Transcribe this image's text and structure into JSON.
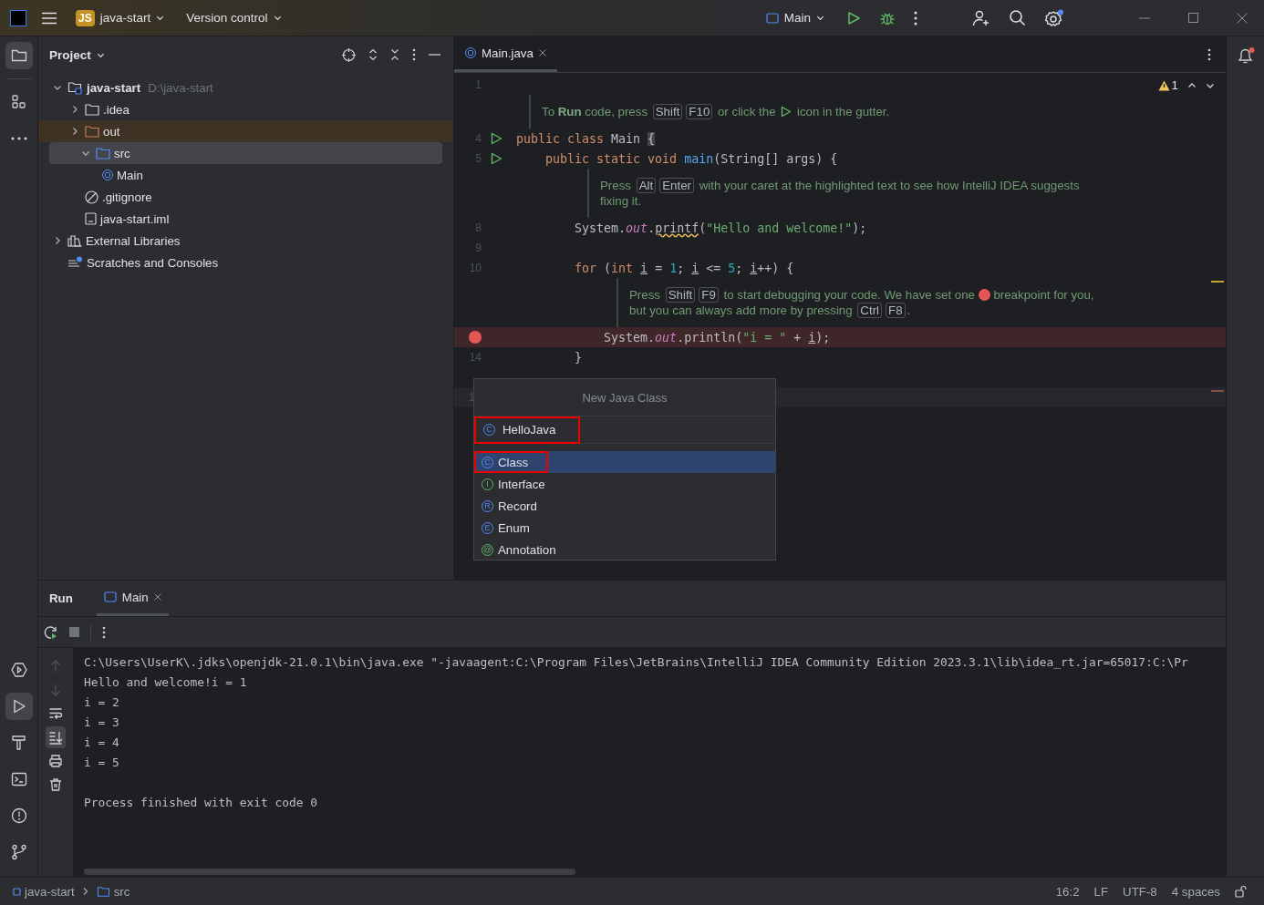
{
  "title_bar": {
    "project_badge": "JS",
    "project": "java-start",
    "vcs": "Version control",
    "run_config": "Main",
    "settings_badge": true
  },
  "left_toolbar_top": [
    {
      "kind": "project",
      "selected": true
    },
    {
      "kind": "structure",
      "selected": false
    },
    {
      "kind": "more",
      "selected": false
    }
  ],
  "left_toolbar_bottom": [
    {
      "kind": "services",
      "selected": false
    },
    {
      "kind": "run",
      "selected": true
    },
    {
      "kind": "build",
      "selected": false
    },
    {
      "kind": "terminal",
      "selected": false
    },
    {
      "kind": "problems",
      "selected": false
    },
    {
      "kind": "git",
      "selected": false
    }
  ],
  "project_panel": {
    "title": "Project",
    "tree": [
      {
        "label": "java-start",
        "path": "D:\\java-start",
        "kind": "module",
        "expanded": true,
        "selected": false,
        "children": [
          {
            "label": ".idea",
            "kind": "folder",
            "expanded": false,
            "selected": false
          },
          {
            "label": "out",
            "kind": "excluded-folder",
            "expanded": false,
            "selected": false
          },
          {
            "label": "src",
            "kind": "source-folder",
            "expanded": true,
            "selected": true,
            "children": [
              {
                "label": "Main",
                "kind": "class",
                "selected": false
              }
            ]
          },
          {
            "label": ".gitignore",
            "kind": "ignore-file",
            "selected": false
          },
          {
            "label": "java-start.iml",
            "kind": "file",
            "selected": false
          }
        ]
      },
      {
        "label": "External Libraries",
        "kind": "libraries",
        "expanded": false,
        "selected": false
      },
      {
        "label": "Scratches and Consoles",
        "kind": "scratches",
        "selected": false
      }
    ]
  },
  "editor": {
    "tab": {
      "label": "Main.java",
      "selected": true
    },
    "warnings": "1",
    "lines": [
      {
        "kind": "code",
        "number": "1",
        "current": false
      },
      {
        "kind": "hint",
        "parts": [
          {
            "kind": "text",
            "text": "To "
          },
          {
            "kind": "bold",
            "text": "Run"
          },
          {
            "kind": "text",
            "text": " code, press "
          },
          {
            "kind": "key",
            "text": "Shift"
          },
          {
            "kind": "key",
            "text": "F10"
          },
          {
            "kind": "text",
            "text": " or click the "
          },
          {
            "kind": "run-icon"
          },
          {
            "kind": "text",
            "text": " icon in the gutter."
          }
        ]
      },
      {
        "kind": "code",
        "number": "4",
        "runnable": true,
        "current": false,
        "tokens": [
          {
            "kind": "kw",
            "text": "public class "
          },
          {
            "kind": "plain",
            "text": "Main "
          },
          {
            "kind": "brace",
            "text": "{"
          }
        ]
      },
      {
        "kind": "code",
        "number": "5",
        "runnable": true,
        "current": false,
        "tokens": [
          {
            "kind": "kw",
            "text": "    public static void "
          },
          {
            "kind": "method",
            "text": "main"
          },
          {
            "kind": "plain",
            "text": "(String[] args) {"
          }
        ]
      },
      {
        "kind": "hint",
        "parts": [
          {
            "kind": "text",
            "text": "Press "
          },
          {
            "kind": "key",
            "text": "Alt"
          },
          {
            "kind": "key",
            "text": "Enter"
          },
          {
            "kind": "text",
            "text": " with your caret at the highlighted text to see how IntelliJ IDEA suggests"
          },
          {
            "kind": "break"
          },
          {
            "kind": "text",
            "text": "fixing it."
          }
        ]
      },
      {
        "kind": "code",
        "number": "8",
        "current": false,
        "tokens": [
          {
            "kind": "plain",
            "text": "        System."
          },
          {
            "kind": "field",
            "text": "out"
          },
          {
            "kind": "plain",
            "text": "."
          },
          {
            "kind": "warn",
            "text": "printf"
          },
          {
            "kind": "plain",
            "text": "("
          },
          {
            "kind": "string",
            "text": "\"Hello and welcome!\""
          },
          {
            "kind": "plain",
            "text": ");"
          }
        ]
      },
      {
        "kind": "code",
        "number": "9",
        "current": false
      },
      {
        "kind": "code",
        "number": "10",
        "current": false,
        "tokens": [
          {
            "kind": "kw",
            "text": "        for"
          },
          {
            "kind": "plain",
            "text": " ("
          },
          {
            "kind": "kw",
            "text": "int "
          },
          {
            "kind": "var",
            "text": "i"
          },
          {
            "kind": "plain",
            "text": " = "
          },
          {
            "kind": "num",
            "text": "1"
          },
          {
            "kind": "plain",
            "text": "; "
          },
          {
            "kind": "var",
            "text": "i"
          },
          {
            "kind": "plain",
            "text": " <= "
          },
          {
            "kind": "num",
            "text": "5"
          },
          {
            "kind": "plain",
            "text": "; "
          },
          {
            "kind": "var",
            "text": "i"
          },
          {
            "kind": "plain",
            "text": "++) {"
          }
        ]
      },
      {
        "kind": "hint",
        "parts": [
          {
            "kind": "text",
            "text": "Press "
          },
          {
            "kind": "key",
            "text": "Shift"
          },
          {
            "kind": "key",
            "text": "F9"
          },
          {
            "kind": "text",
            "text": " to start debugging your code. We have set one "
          },
          {
            "kind": "breakpoint-dot"
          },
          {
            "kind": "text",
            "text": " breakpoint for you,"
          },
          {
            "kind": "break"
          },
          {
            "kind": "text",
            "text": "but you can always add more by pressing "
          },
          {
            "kind": "key",
            "text": "Ctrl"
          },
          {
            "kind": "key",
            "text": "F8"
          },
          {
            "kind": "text",
            "text": "."
          }
        ]
      },
      {
        "kind": "code",
        "breakpoint": true,
        "current": false,
        "tokens": [
          {
            "kind": "plain",
            "text": "            System."
          },
          {
            "kind": "field",
            "text": "out"
          },
          {
            "kind": "plain",
            "text": ".println("
          },
          {
            "kind": "string",
            "text": "\"i = \""
          },
          {
            "kind": "plain",
            "text": " + "
          },
          {
            "kind": "var",
            "text": "i"
          },
          {
            "kind": "plain",
            "text": ");"
          }
        ]
      },
      {
        "kind": "code",
        "number": "14",
        "current": false,
        "tokens": [
          {
            "kind": "plain",
            "text": "        }"
          }
        ]
      },
      {
        "kind": "code",
        "current": false
      },
      {
        "kind": "code",
        "number": "1",
        "current": true
      }
    ]
  },
  "popup": {
    "title": "New Java Class",
    "field": {
      "icon": "C",
      "value": "HelloJava",
      "highlighted": true
    },
    "items": [
      {
        "label": "Class",
        "icon": "C",
        "kind": "class",
        "selected": true,
        "highlighted": true
      },
      {
        "label": "Interface",
        "icon": "I",
        "kind": "interface",
        "selected": false,
        "highlighted": false
      },
      {
        "label": "Record",
        "icon": "R",
        "kind": "record",
        "selected": false,
        "highlighted": false
      },
      {
        "label": "Enum",
        "icon": "E",
        "kind": "enum",
        "selected": false,
        "highlighted": false
      },
      {
        "label": "Annotation",
        "icon": "@",
        "kind": "annotation",
        "selected": false,
        "highlighted": false
      }
    ]
  },
  "run_panel": {
    "title": "Run",
    "tabs": [
      {
        "label": "Main",
        "selected": true
      }
    ],
    "side_tools": [
      {
        "kind": "up",
        "disabled": true,
        "selected": false
      },
      {
        "kind": "down",
        "disabled": true,
        "selected": false
      },
      {
        "kind": "wrap",
        "disabled": false,
        "selected": false
      },
      {
        "kind": "scroll-end",
        "disabled": false,
        "selected": true
      },
      {
        "kind": "print",
        "disabled": false,
        "selected": false
      },
      {
        "kind": "delete",
        "disabled": false,
        "selected": false
      }
    ],
    "console": [
      "C:\\Users\\UserK\\.jdks\\openjdk-21.0.1\\bin\\java.exe \"-javaagent:C:\\Program Files\\JetBrains\\IntelliJ IDEA Community Edition 2023.3.1\\lib\\idea_rt.jar=65017:C:\\Pr",
      "Hello and welcome!i = 1",
      "i = 2",
      "i = 3",
      "i = 4",
      "i = 5",
      "Process finished with exit code 0"
    ]
  },
  "notifications": {
    "unread": true
  },
  "status_bar": {
    "breadcrumbs": [
      {
        "label": "java-start",
        "kind": "module"
      },
      {
        "label": "src",
        "kind": "folder"
      }
    ],
    "items": [
      "16:2",
      "LF",
      "UTF-8",
      "4 spaces"
    ]
  }
}
